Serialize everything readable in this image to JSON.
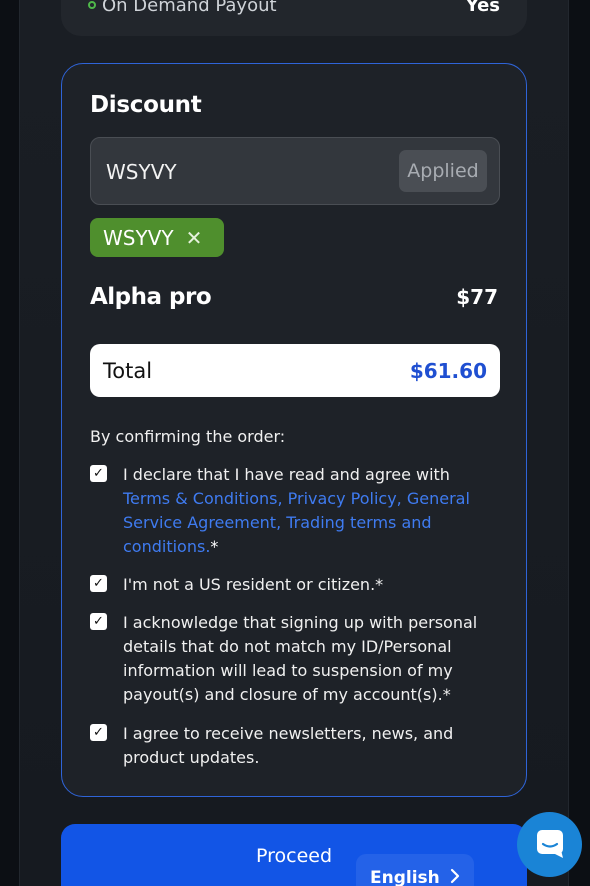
{
  "top_card": {
    "label": "On Demand Payout",
    "value": "Yes"
  },
  "discount": {
    "title": "Discount",
    "code_value": "WSYVY",
    "applied_label": "Applied",
    "chip_label": "WSYVY"
  },
  "product": {
    "name": "Alpha pro",
    "price": "$77"
  },
  "total": {
    "label": "Total",
    "value": "$61.60"
  },
  "confirm": {
    "lead": "By confirming the order:",
    "item1_text": "I declare that I have read and agree with",
    "item1_links": " Terms & Conditions,  Privacy Policy,  General Service Agreement, Trading terms and conditions.",
    "item2_text": "I'm not a US resident or citizen.",
    "item3_text": "I acknowledge that signing up with personal details that do not match my ID/Personal information will lead to suspension of my payout(s) and closure of my account(s).",
    "item4_text": "I agree to receive newsletters, news, and product updates.",
    "required_mark": "*"
  },
  "actions": {
    "proceed_label": "Proceed",
    "language_label": "English"
  },
  "colors": {
    "accent": "#1255e6",
    "link": "#3f7bf0",
    "chip": "#4f8f2d",
    "border": "#2f64d8"
  }
}
